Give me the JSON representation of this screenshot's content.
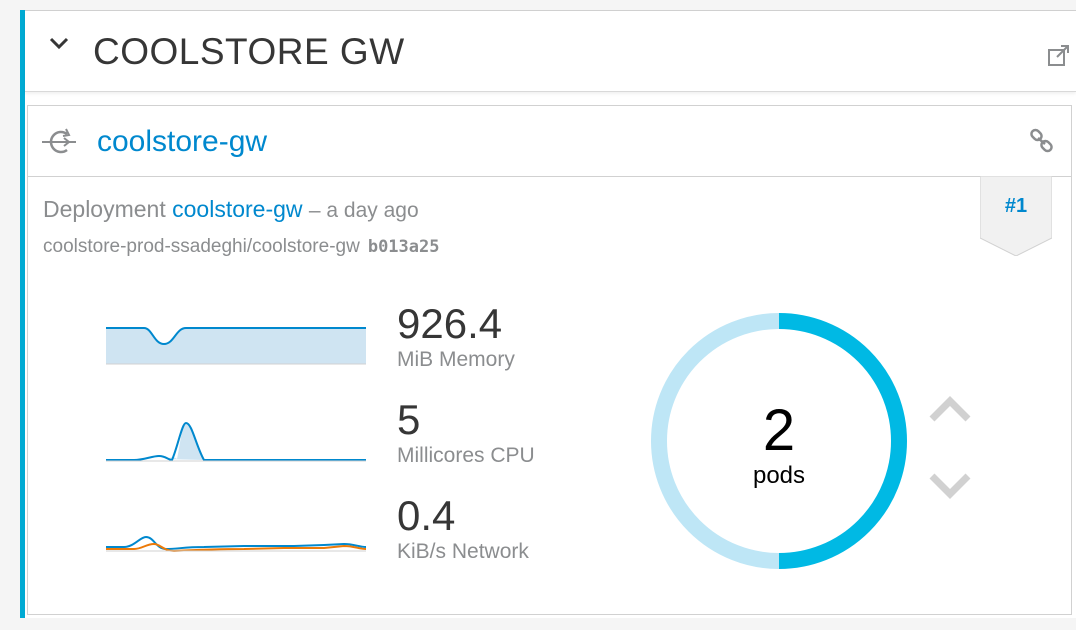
{
  "app": {
    "title": "COOLSTORE GW"
  },
  "service": {
    "name": "coolstore-gw"
  },
  "deployment": {
    "prefix": "Deployment",
    "name": "coolstore-gw",
    "age": "– a day ago",
    "image": "coolstore-prod-ssadeghi/coolstore-gw",
    "commit": "b013a25",
    "revision": "#1"
  },
  "metrics": [
    {
      "value": "926.4",
      "label": "MiB Memory"
    },
    {
      "value": "5",
      "label": "Millicores CPU"
    },
    {
      "value": "0.4",
      "label": "KiB/s Network"
    }
  ],
  "pods": {
    "count": "2",
    "label": "pods",
    "running": 1,
    "other": 1
  },
  "colors": {
    "accent": "#00aad3",
    "link": "#0088ce",
    "donut_primary": "#00b9e4",
    "donut_secondary": "#bee6f6",
    "sparkline_blue": "#0088ce",
    "sparkline_orange": "#ec7a08",
    "sparkline_fill": "#cfe4f2"
  },
  "icons": {
    "collapse": "chevron-down-icon",
    "external": "external-link-icon",
    "service": "service-icon",
    "route": "link-icon",
    "scale_up": "chevron-up-icon",
    "scale_down": "chevron-down-icon"
  }
}
